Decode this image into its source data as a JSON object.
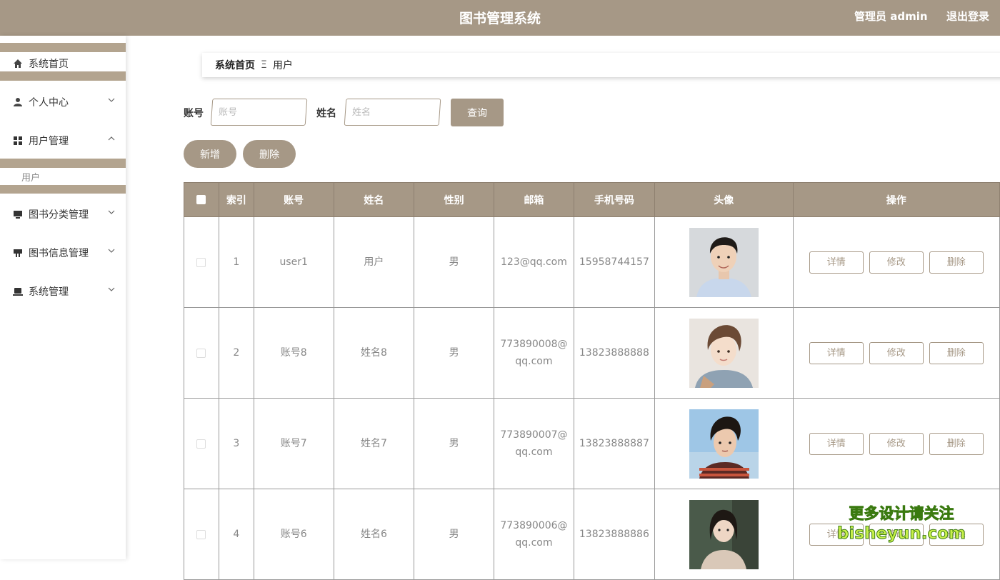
{
  "header": {
    "title": "图书管理系统",
    "admin_label": "管理员 admin",
    "logout_label": "退出登录"
  },
  "sidebar": {
    "home": "系统首页",
    "personal": "个人中心",
    "user_mgmt": "用户管理",
    "user_sub": "用户",
    "book_category": "图书分类管理",
    "book_info": "图书信息管理",
    "system": "系统管理"
  },
  "breadcrumb": {
    "home": "系统首页",
    "separator": "Ξ",
    "current": "用户"
  },
  "search": {
    "account_label": "账号",
    "account_placeholder": "账号",
    "name_label": "姓名",
    "name_placeholder": "姓名",
    "query_label": "查询"
  },
  "actions": {
    "add_label": "新增",
    "delete_label": "删除"
  },
  "table": {
    "headers": [
      "索引",
      "账号",
      "姓名",
      "性别",
      "邮箱",
      "手机号码",
      "头像",
      "操作"
    ],
    "rows": [
      {
        "index": "1",
        "account": "user1",
        "name": "用户",
        "gender": "男",
        "email_1": "123@qq.com",
        "email_2": "",
        "phone": "15958744157"
      },
      {
        "index": "2",
        "account": "账号8",
        "name": "姓名8",
        "gender": "男",
        "email_1": "773890008@",
        "email_2": "qq.com",
        "phone": "13823888888"
      },
      {
        "index": "3",
        "account": "账号7",
        "name": "姓名7",
        "gender": "男",
        "email_1": "773890007@",
        "email_2": "qq.com",
        "phone": "13823888887"
      },
      {
        "index": "4",
        "account": "账号6",
        "name": "姓名6",
        "gender": "男",
        "email_1": "773890006@",
        "email_2": "qq.com",
        "phone": "13823888886"
      }
    ],
    "op_detail": "详情",
    "op_edit": "修改",
    "op_delete": "删除"
  },
  "watermark": {
    "line1": "更多设计请关注",
    "line2": "bisheyun.com"
  },
  "colors": {
    "accent": "#a69886",
    "band": "#b3a48f"
  }
}
